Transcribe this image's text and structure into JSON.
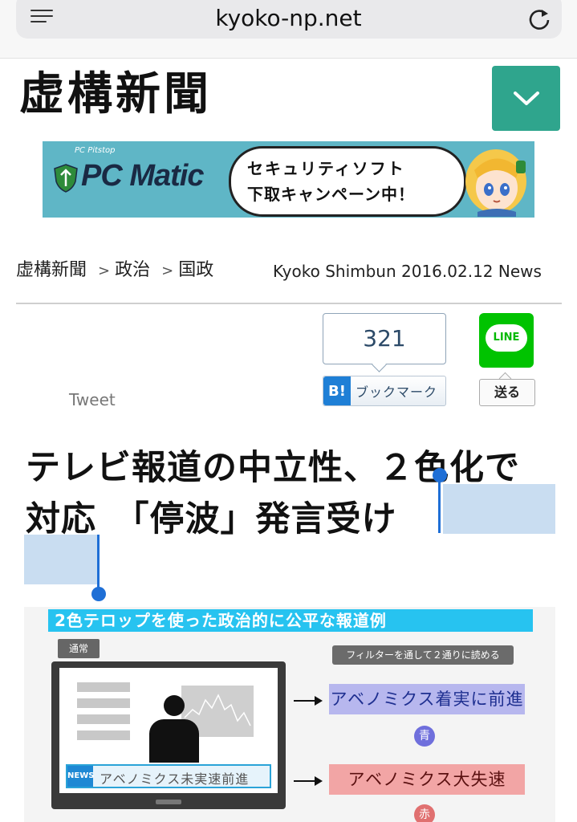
{
  "browser": {
    "url": "kyoko-np.net",
    "menu_icon": "hamburger-icon",
    "reload_icon": "reload-icon"
  },
  "site": {
    "logo": "虚構新聞",
    "menu_toggle_icon": "chevron-down-icon",
    "accent_color": "#2fa58d"
  },
  "banner": {
    "brand_small": "PC Pitstop",
    "brand": "PC Matic",
    "line1": "セキュリティソフト",
    "line2": "下取キャンペーン中！"
  },
  "breadcrumb": {
    "items": [
      "虚構新聞",
      "政治",
      "国政"
    ],
    "separator": ">",
    "byline": "Kyoko Shimbun 2016.02.12 News"
  },
  "social": {
    "tweet_label": "Tweet",
    "hatena_count": "321",
    "hatena_b": "B!",
    "hatena_label": "ブックマーク",
    "line_logo": "LINE",
    "line_send": "送る"
  },
  "article": {
    "headline_line1": "テレビ報道の中立性、２色化で",
    "headline_line2": "対応　「停波」発言受け"
  },
  "figure": {
    "title": "2色テロップを使った政治的に公平な報道例",
    "normal_tag": "通常",
    "news_tag": "NEWS",
    "caption": "アベノミクス未実速前進",
    "filter_note": "フィルターを通して２通りに読める",
    "blue_reading": "アベノミクス着実に前進",
    "blue_chip": "青",
    "red_reading": "アベノミクス大失速",
    "red_chip": "赤"
  }
}
